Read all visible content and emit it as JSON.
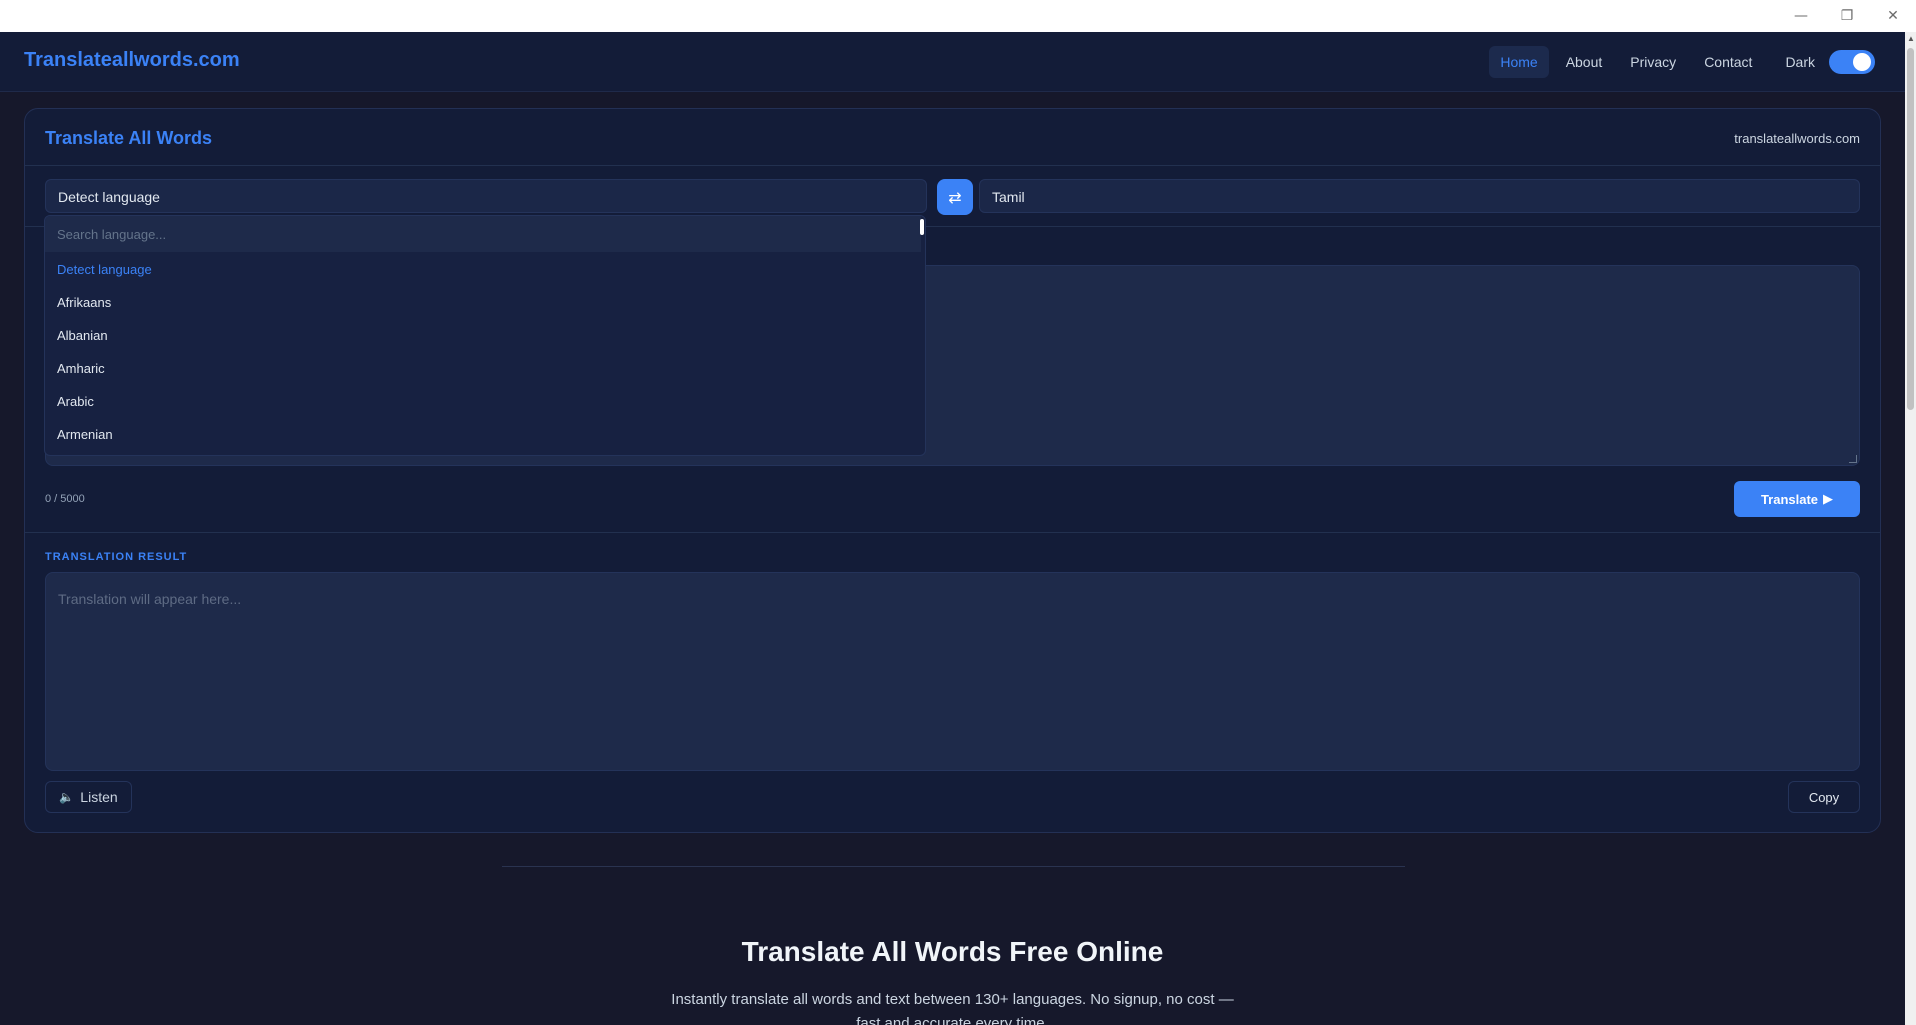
{
  "window": {
    "minimize_glyph": "—",
    "maximize_glyph": "❐",
    "close_glyph": "✕"
  },
  "navbar": {
    "brand": "Translateallwords.com",
    "items": [
      {
        "label": "Home",
        "active": true
      },
      {
        "label": "About",
        "active": false
      },
      {
        "label": "Privacy",
        "active": false
      },
      {
        "label": "Contact",
        "active": false
      }
    ],
    "theme_label": "Dark",
    "theme_toggle_on": true
  },
  "card": {
    "title": "Translate All Words",
    "site": "translateallwords.com",
    "source_language": "Detect language",
    "target_language": "Tamil",
    "swap_icon": "⇄",
    "char_count": "0 / 5000",
    "translate_label": "Translate",
    "translate_icon": "▶",
    "result_label": "TRANSLATION RESULT",
    "result_placeholder": "Translation will appear here...",
    "listen_icon": "🔈",
    "listen_label": "Listen",
    "copy_label": "Copy"
  },
  "dropdown": {
    "search_placeholder": "Search language...",
    "options": [
      {
        "label": "Detect language",
        "selected": true
      },
      {
        "label": "Afrikaans",
        "selected": false
      },
      {
        "label": "Albanian",
        "selected": false
      },
      {
        "label": "Amharic",
        "selected": false
      },
      {
        "label": "Arabic",
        "selected": false
      },
      {
        "label": "Armenian",
        "selected": false
      }
    ]
  },
  "hero": {
    "title": "Translate All Words Free Online",
    "subtitle": "Instantly translate all words and text between 130+ languages. No signup, no cost — fast and accurate every time."
  },
  "colors": {
    "accent": "#3b82f6",
    "background": "#16182b",
    "panel": "#131c38"
  }
}
